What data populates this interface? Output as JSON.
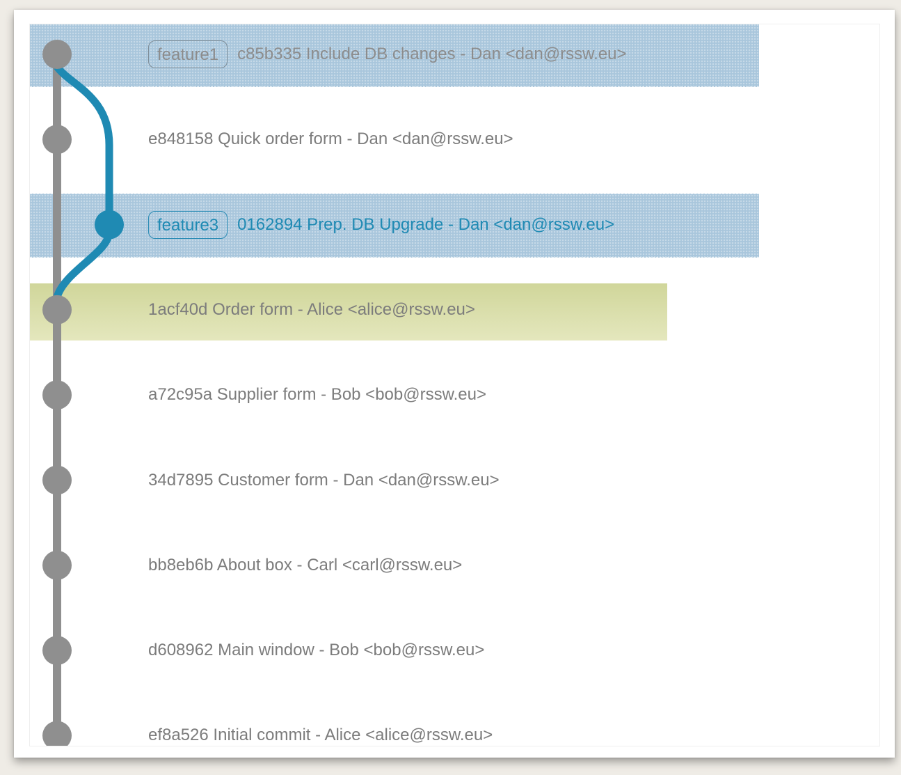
{
  "commits": [
    {
      "tag": "feature1",
      "text": "c85b335 Include DB changes - Dan <dan@rssw.eu>",
      "highlight": "blue",
      "branch": "main"
    },
    {
      "tag": "",
      "text": "e848158 Quick order form - Dan <dan@rssw.eu>",
      "highlight": "none",
      "branch": "main"
    },
    {
      "tag": "feature3",
      "text": "0162894 Prep. DB Upgrade - Dan <dan@rssw.eu>",
      "highlight": "blue",
      "branch": "feature"
    },
    {
      "tag": "",
      "text": "1acf40d Order form - Alice <alice@rssw.eu>",
      "highlight": "green",
      "branch": "main"
    },
    {
      "tag": "",
      "text": "a72c95a Supplier form - Bob <bob@rssw.eu>",
      "highlight": "none",
      "branch": "main"
    },
    {
      "tag": "",
      "text": "34d7895 Customer form - Dan <dan@rssw.eu>",
      "highlight": "none",
      "branch": "main"
    },
    {
      "tag": "",
      "text": "bb8eb6b About box - Carl <carl@rssw.eu>",
      "highlight": "none",
      "branch": "main"
    },
    {
      "tag": "",
      "text": "d608962 Main window - Bob <bob@rssw.eu>",
      "highlight": "none",
      "branch": "main"
    },
    {
      "tag": "",
      "text": "ef8a526 Initial commit - Alice <alice@rssw.eu>",
      "highlight": "none",
      "branch": "main"
    }
  ],
  "colors": {
    "main_branch": "#8f8f8f",
    "feature_branch": "#1f8ab3",
    "highlight_blue": "#a9c6dc",
    "highlight_green": "#d6dca5"
  }
}
